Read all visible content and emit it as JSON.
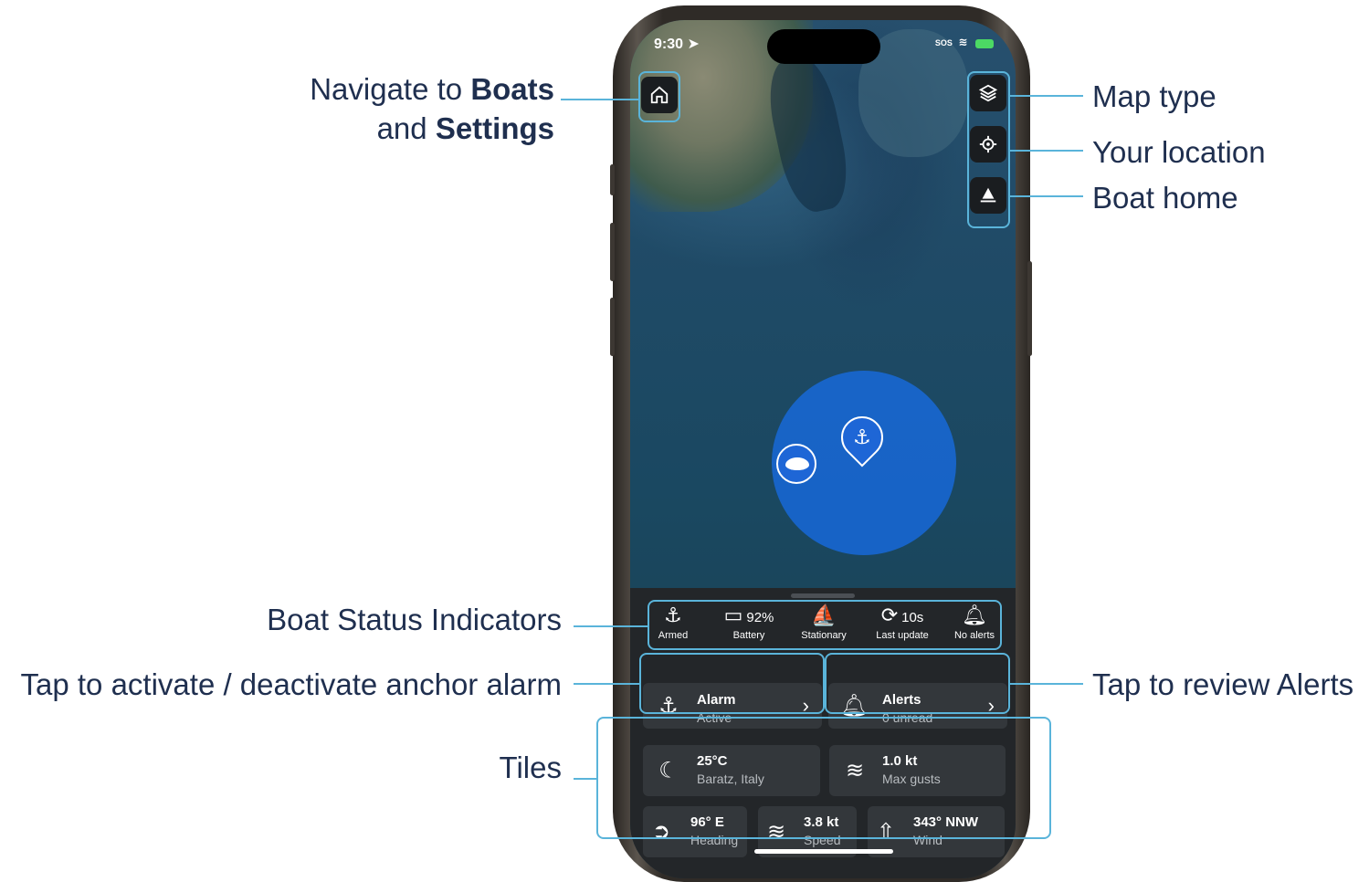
{
  "callouts": {
    "nav_pre": "Navigate to",
    "nav_boats": "Boats",
    "nav_and": "and",
    "nav_settings": "Settings",
    "map_type": "Map type",
    "your_location": "Your location",
    "boat_home": "Boat home",
    "status_indicators": "Boat Status Indicators",
    "anchor_alarm": "Tap to activate / deactivate anchor alarm",
    "review_alerts": "Tap to review Alerts",
    "tiles": "Tiles"
  },
  "status_bar": {
    "time": "9:30",
    "sos": "SOS"
  },
  "indicators": [
    {
      "icon": "anchor-check-icon",
      "value": "",
      "label": "Armed"
    },
    {
      "icon": "battery-icon",
      "value": "92%",
      "label": "Battery"
    },
    {
      "icon": "sailboat-icon",
      "value": "",
      "label": "Stationary"
    },
    {
      "icon": "refresh-icon",
      "value": "10s",
      "label": "Last update"
    },
    {
      "icon": "bell-icon",
      "value": "",
      "label": "No alerts"
    }
  ],
  "alarm_card": {
    "title": "Alarm",
    "subtitle": "Active"
  },
  "alerts_card": {
    "title": "Alerts",
    "subtitle": "0 unread"
  },
  "tiles": {
    "weather": {
      "value": "25°C",
      "label": "Baratz, Italy"
    },
    "gusts": {
      "value": "1.0 kt",
      "label": "Max gusts"
    },
    "heading": {
      "value": "96° E",
      "label": "Heading"
    },
    "speed": {
      "value": "3.8 kt",
      "label": "Speed"
    },
    "wind": {
      "value": "343° NNW",
      "label": "Wind"
    }
  },
  "colors": {
    "accent": "#5ab4da",
    "callout_text": "#1f2f4f",
    "panel": "#232629",
    "card": "#33373b",
    "range": "#1768d8"
  }
}
